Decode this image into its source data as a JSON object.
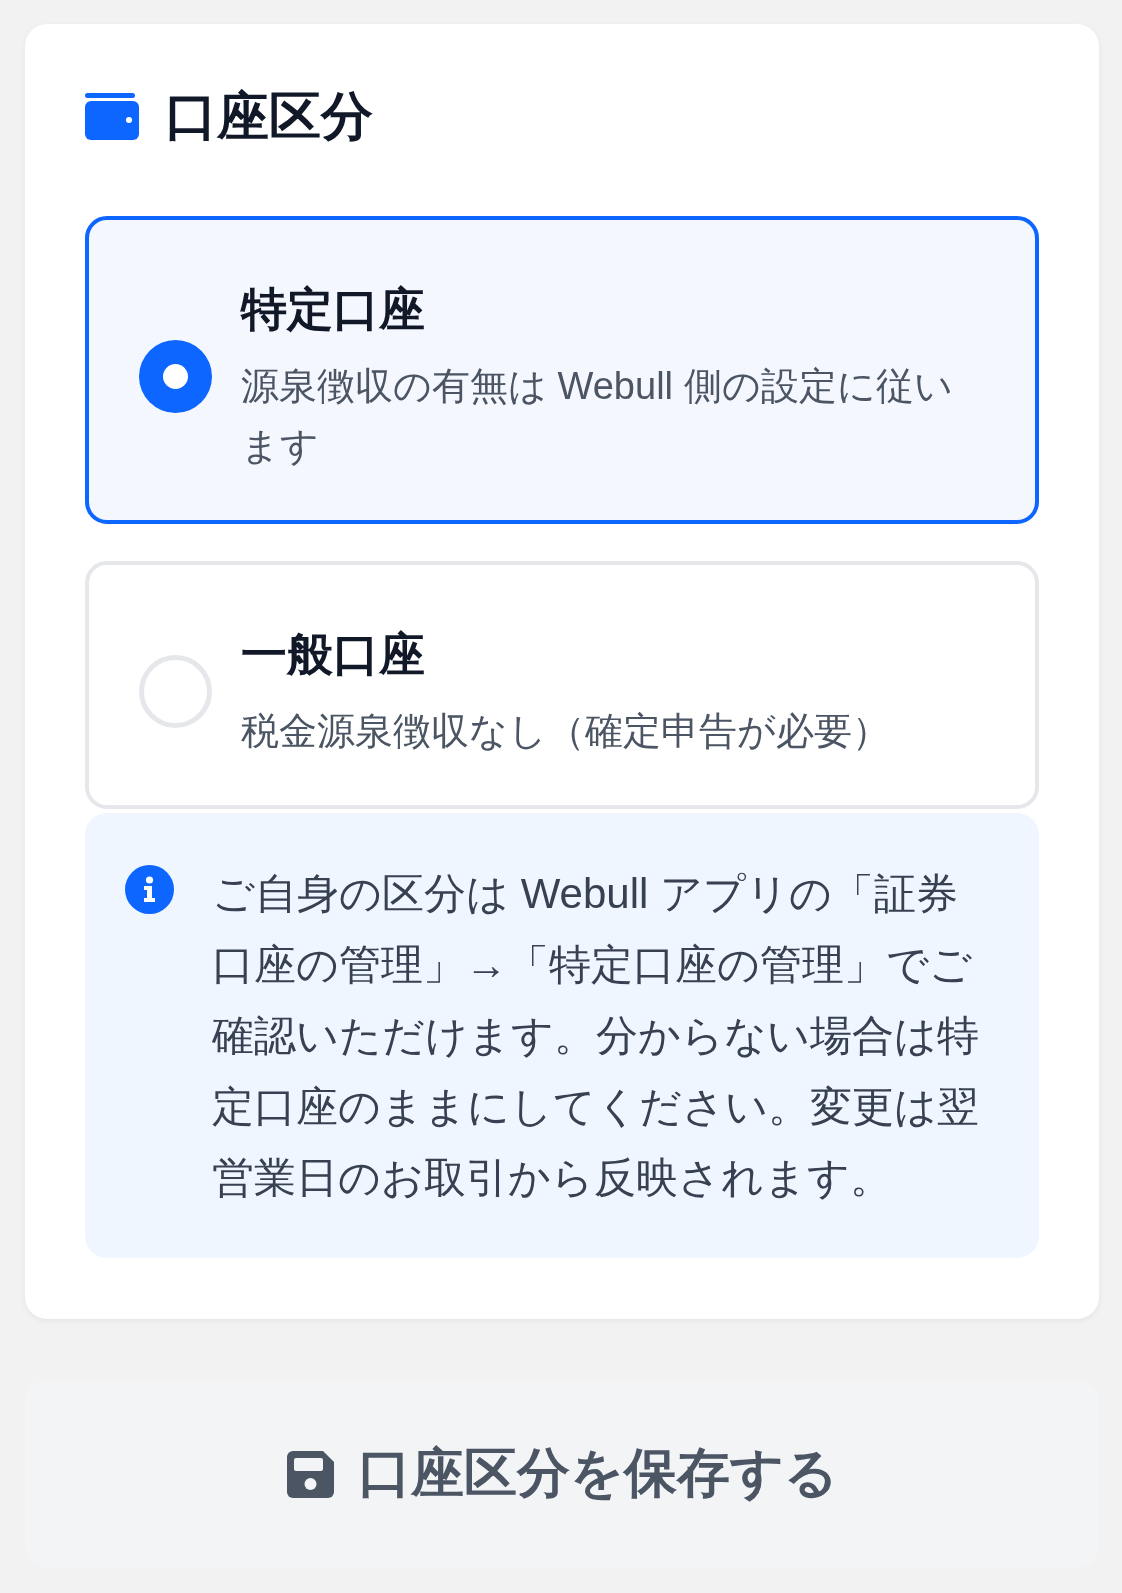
{
  "section": {
    "title": "口座区分"
  },
  "options": [
    {
      "title": "特定口座",
      "description": "源泉徴収の有無は Webull 側の設定に従います",
      "selected": true
    },
    {
      "title": "一般口座",
      "description": "税金源泉徴収なし（確定申告が必要）",
      "selected": false
    }
  ],
  "info": {
    "text": "ご自身の区分は Webull アプリの「証券口座の管理」→「特定口座の管理」でご確認いただけます。分からない場合は特定口座のままにしてください。変更は翌営業日のお取引から反映されます。"
  },
  "save_button": {
    "label": "口座区分を保存する"
  }
}
